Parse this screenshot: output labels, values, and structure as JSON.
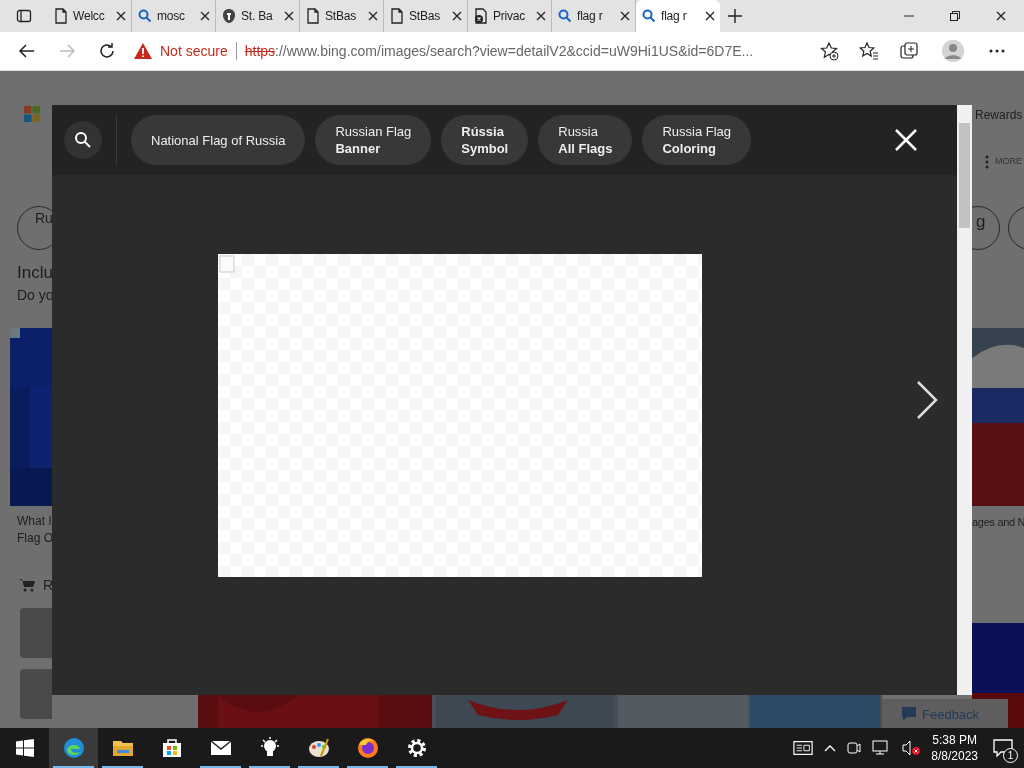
{
  "browser": {
    "tabs": [
      {
        "title": "Welcc",
        "kind": "page",
        "selected": false
      },
      {
        "title": "mosc",
        "kind": "search",
        "selected": false
      },
      {
        "title": "St. Ba",
        "kind": "shield",
        "selected": false
      },
      {
        "title": "StBas",
        "kind": "page",
        "selected": false
      },
      {
        "title": "StBas",
        "kind": "page",
        "selected": false
      },
      {
        "title": "Privac",
        "kind": "blocked",
        "selected": false
      },
      {
        "title": "flag r",
        "kind": "search",
        "selected": false
      },
      {
        "title": "flag r",
        "kind": "search",
        "selected": true
      }
    ],
    "security": "Not secure",
    "url_scheme": "https",
    "url_rest": "://www.bing.com/images/search?view=detailV2&ccid=uW9Hi1US&id=6D7E..."
  },
  "background_page": {
    "left": {
      "chip": "Ru",
      "heading": "Inclu",
      "subheading": "Do yo",
      "caption": [
        "What I",
        "Flag O"
      ],
      "cart_label": "R"
    },
    "right": {
      "rewards": "Rewards",
      "more": "MORE",
      "chip": "g",
      "caption": "ages and N"
    },
    "feedback": "Feedback"
  },
  "viewer": {
    "chips": [
      {
        "lines": [
          {
            "text": "National Flag of Russia",
            "bold": false
          }
        ]
      },
      {
        "lines": [
          {
            "text": "Russian Flag",
            "bold": false
          },
          {
            "text": "Banner",
            "bold": true
          }
        ]
      },
      {
        "lines": [
          {
            "text": "Rússia",
            "bold": true
          },
          {
            "text": "Symbol",
            "bold": true
          }
        ]
      },
      {
        "lines": [
          {
            "text": "Russia",
            "bold": false
          },
          {
            "text": "All Flags",
            "bold": true
          }
        ]
      },
      {
        "lines": [
          {
            "text": "Russia Flag",
            "bold": false
          },
          {
            "text": "Coloring",
            "bold": true
          }
        ]
      }
    ]
  },
  "taskbar": {
    "apps": [
      {
        "kind": "edge",
        "running": true,
        "active": true
      },
      {
        "kind": "folder",
        "running": true,
        "active": false
      },
      {
        "kind": "store",
        "running": false,
        "active": false
      },
      {
        "kind": "mail",
        "running": true,
        "active": false
      },
      {
        "kind": "bulb",
        "running": true,
        "active": false
      },
      {
        "kind": "palette",
        "running": true,
        "active": false
      },
      {
        "kind": "firefox",
        "running": true,
        "active": false
      },
      {
        "kind": "gear",
        "running": true,
        "active": false
      }
    ],
    "time": "5:38 PM",
    "date": "8/8/2023",
    "notifications": "1"
  }
}
